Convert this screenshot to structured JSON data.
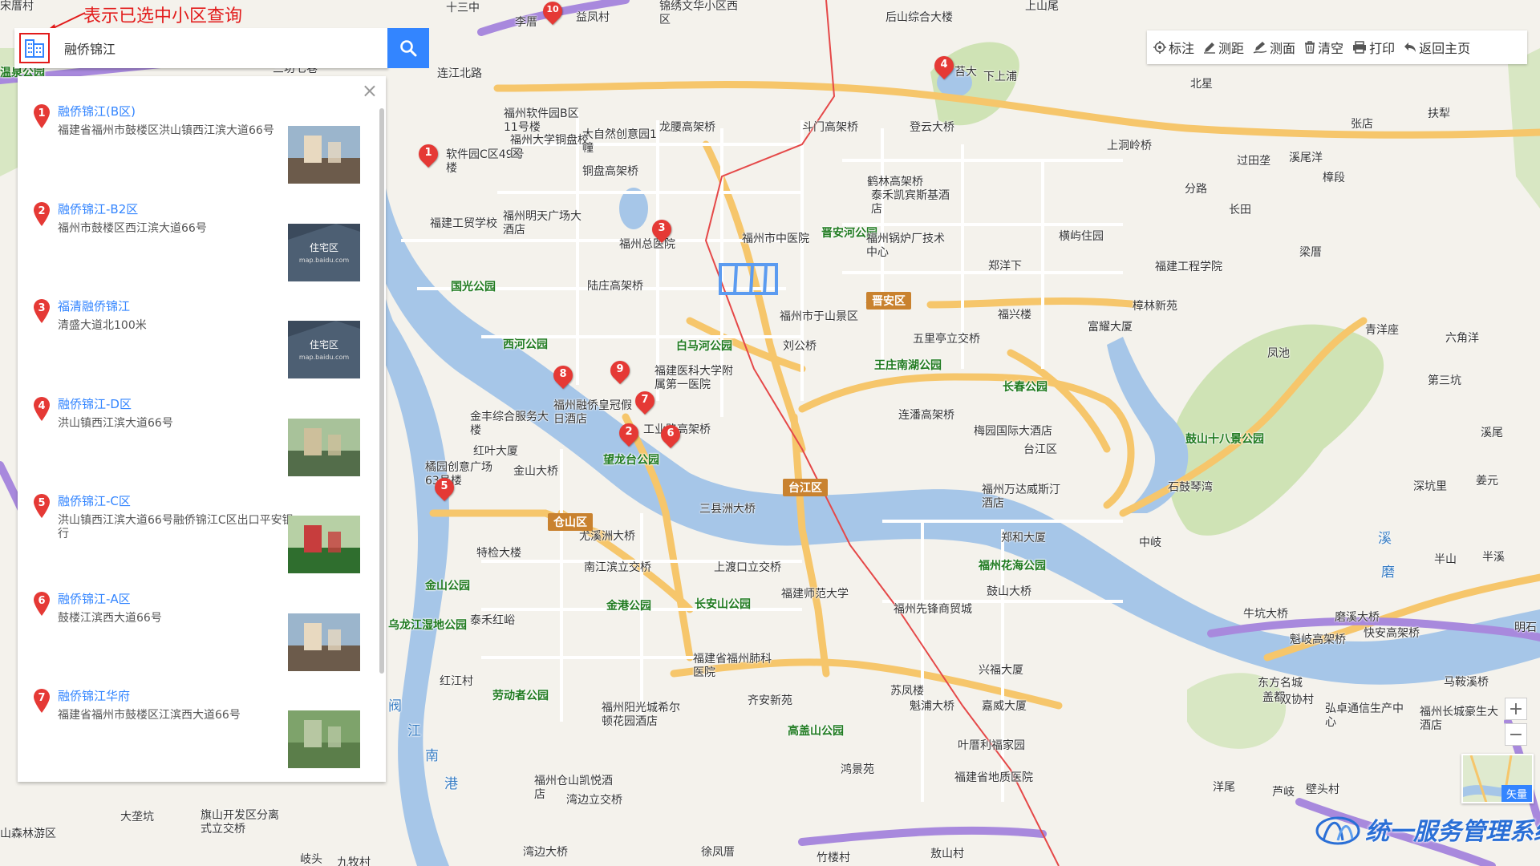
{
  "annotation": {
    "text": "表示已选中小区查询"
  },
  "search": {
    "value": "融侨锦江",
    "placeholder": ""
  },
  "results": [
    {
      "num": "1",
      "name": "融侨锦江(B区)",
      "address": "福建省福州市鼓楼区洪山镇西江滨大道66号",
      "thumb": "photo"
    },
    {
      "num": "2",
      "name": "融侨锦江-B2区",
      "address": "福州市鼓楼区西江滨大道66号",
      "thumb": "placeholder"
    },
    {
      "num": "3",
      "name": "福清融侨锦江",
      "address": "清盛大道北100米",
      "thumb": "placeholder"
    },
    {
      "num": "4",
      "name": "融侨锦江-D区",
      "address": "洪山镇西江滨大道66号",
      "thumb": "photo"
    },
    {
      "num": "5",
      "name": "融侨锦江-C区",
      "address": "洪山镇西江滨大道66号融侨锦江C区出口平安银行",
      "thumb": "photo"
    },
    {
      "num": "6",
      "name": "融侨锦江-A区",
      "address": "鼓楼江滨西大道66号",
      "thumb": "photo"
    },
    {
      "num": "7",
      "name": "融侨锦江华府",
      "address": "福建省福州市鼓楼区江滨西大道66号",
      "thumb": "photo"
    }
  ],
  "thumb_placeholder": {
    "title": "住宅区",
    "subtitle": "map.baidu.com"
  },
  "toolbar": {
    "items": [
      {
        "label": "标注",
        "icon": "locate-icon"
      },
      {
        "label": "测距",
        "icon": "ruler-pen-icon"
      },
      {
        "label": "测面",
        "icon": "area-pen-icon"
      },
      {
        "label": "清空",
        "icon": "trash-icon"
      },
      {
        "label": "打印",
        "icon": "printer-icon"
      },
      {
        "label": "返回主页",
        "icon": "back-arrow-icon"
      }
    ]
  },
  "zoom": {
    "in": "+",
    "out": "−"
  },
  "vector_label": "矢量",
  "watermark": "统一服务管理系统",
  "map_labels": [
    "十三中",
    "李厝",
    "益凤村",
    "锦绣文华小区西区",
    "后山综合大楼",
    "上山尾",
    "连江北路",
    "温泉公园",
    "三坊七巷",
    "福州软件园B区11号楼",
    "大自然创意园1幢",
    "龙腰高架桥",
    "软件园C区49号楼",
    "福州大学铜盘校区",
    "斗门高架桥",
    "登云大桥",
    "苔大",
    "下上浦",
    "北星",
    "上洞岭桥",
    "张店",
    "扶犁",
    "过田垄",
    "溪尾洋",
    "樟段",
    "分路",
    "长田",
    "铜盘高架桥",
    "福建工贸学校",
    "福州明天广场大酒店",
    "福州总医院",
    "福州市中医院",
    "晋安河公园",
    "福州锅炉厂技术中心",
    "鹤林高架桥",
    "泰禾凯宾斯基酒店",
    "横屿住园",
    "福建工程学院",
    "梁厝",
    "樟林新苑",
    "郑洋下",
    "国光公园",
    "陆庄高架桥",
    "福州市于山景区",
    "刘公桥",
    "晋安区",
    "福兴楼",
    "富耀大厦",
    "青洋座",
    "六角洋",
    "西河公园",
    "白马河公园",
    "王庄南湖公园",
    "五里亭立交桥",
    "凤池",
    "第三坑",
    "福建医科大学附属第一医院",
    "福州融侨皇冠假日酒店",
    "长春公园",
    "连潘高架桥",
    "梅园国际大酒店",
    "鼓山十八景公园",
    "溪尾",
    "金丰综合服务大楼",
    "工业路高架桥",
    "红叶大厦",
    "望龙台公园",
    "台江区",
    "橘园创意广场63号楼",
    "金山大桥",
    "福州万达威斯汀酒店",
    "石鼓琴湾",
    "深坑里",
    "姜元",
    "三县洲大桥",
    "仓山区",
    "尤溪洲大桥",
    "郑和大厦",
    "中岐",
    "特检大楼",
    "南江滨立交桥",
    "上渡口立交桥",
    "福建师范大学",
    "福州花海公园",
    "鼓山大桥",
    "半山",
    "半溪",
    "金山公园",
    "金港公园",
    "长安山公园",
    "牛坑大桥",
    "磨溪大桥",
    "乌龙江湿地公园",
    "泰禾红峪",
    "福州先锋商贸城",
    "魁岐高架桥",
    "快安高架桥",
    "明石",
    "福建省福州肺科医院",
    "兴福大厦",
    "东方名城",
    "马鞍溪桥",
    "红江村",
    "劳动者公园",
    "齐安新苑",
    "苏凤楼",
    "嘉威大厦",
    "盖都",
    "双协村",
    "弘卓通信生产中心",
    "福州阳光城希尔顿花园酒店",
    "高盖山公园",
    "魁浦大桥",
    "福州长城豪生大酒店",
    "叶厝利福家园",
    "福建省地质医院",
    "洋尾",
    "芦岐",
    "壁头村",
    "福州仓山凯悦酒店",
    "湾边立交桥",
    "鸿景苑",
    "大垄坑",
    "旗山开发区分离式立交桥",
    "湾边大桥",
    "徐凤厝",
    "竹楼村",
    "敖山村",
    "山森林游区",
    "阀",
    "江",
    "南",
    "港",
    "溪",
    "磨",
    "岐头",
    "九牧村",
    "宋厝村"
  ]
}
